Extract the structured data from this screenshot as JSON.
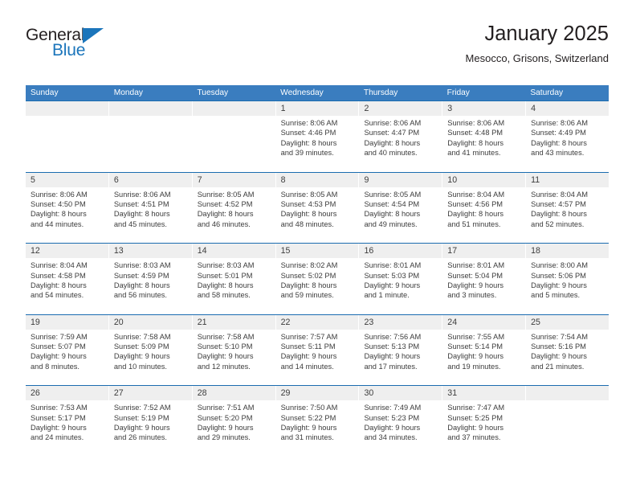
{
  "logo": {
    "line1": "General",
    "line2": "Blue",
    "triangle_color": "#1b75bb",
    "text_color": "#231f20"
  },
  "header": {
    "title": "January 2025",
    "subtitle": "Mesocco, Grisons, Switzerland"
  },
  "colors": {
    "weekday_header_bg": "#3a7dbf",
    "week_divider": "#1b6cb0",
    "day_band_bg": "#efefef",
    "text": "#3c3c3c"
  },
  "weekdays": [
    "Sunday",
    "Monday",
    "Tuesday",
    "Wednesday",
    "Thursday",
    "Friday",
    "Saturday"
  ],
  "weeks": [
    [
      {
        "day": "",
        "sunrise": "",
        "sunset": "",
        "daylight1": "",
        "daylight2": ""
      },
      {
        "day": "",
        "sunrise": "",
        "sunset": "",
        "daylight1": "",
        "daylight2": ""
      },
      {
        "day": "",
        "sunrise": "",
        "sunset": "",
        "daylight1": "",
        "daylight2": ""
      },
      {
        "day": "1",
        "sunrise": "Sunrise: 8:06 AM",
        "sunset": "Sunset: 4:46 PM",
        "daylight1": "Daylight: 8 hours",
        "daylight2": "and 39 minutes."
      },
      {
        "day": "2",
        "sunrise": "Sunrise: 8:06 AM",
        "sunset": "Sunset: 4:47 PM",
        "daylight1": "Daylight: 8 hours",
        "daylight2": "and 40 minutes."
      },
      {
        "day": "3",
        "sunrise": "Sunrise: 8:06 AM",
        "sunset": "Sunset: 4:48 PM",
        "daylight1": "Daylight: 8 hours",
        "daylight2": "and 41 minutes."
      },
      {
        "day": "4",
        "sunrise": "Sunrise: 8:06 AM",
        "sunset": "Sunset: 4:49 PM",
        "daylight1": "Daylight: 8 hours",
        "daylight2": "and 43 minutes."
      }
    ],
    [
      {
        "day": "5",
        "sunrise": "Sunrise: 8:06 AM",
        "sunset": "Sunset: 4:50 PM",
        "daylight1": "Daylight: 8 hours",
        "daylight2": "and 44 minutes."
      },
      {
        "day": "6",
        "sunrise": "Sunrise: 8:06 AM",
        "sunset": "Sunset: 4:51 PM",
        "daylight1": "Daylight: 8 hours",
        "daylight2": "and 45 minutes."
      },
      {
        "day": "7",
        "sunrise": "Sunrise: 8:05 AM",
        "sunset": "Sunset: 4:52 PM",
        "daylight1": "Daylight: 8 hours",
        "daylight2": "and 46 minutes."
      },
      {
        "day": "8",
        "sunrise": "Sunrise: 8:05 AM",
        "sunset": "Sunset: 4:53 PM",
        "daylight1": "Daylight: 8 hours",
        "daylight2": "and 48 minutes."
      },
      {
        "day": "9",
        "sunrise": "Sunrise: 8:05 AM",
        "sunset": "Sunset: 4:54 PM",
        "daylight1": "Daylight: 8 hours",
        "daylight2": "and 49 minutes."
      },
      {
        "day": "10",
        "sunrise": "Sunrise: 8:04 AM",
        "sunset": "Sunset: 4:56 PM",
        "daylight1": "Daylight: 8 hours",
        "daylight2": "and 51 minutes."
      },
      {
        "day": "11",
        "sunrise": "Sunrise: 8:04 AM",
        "sunset": "Sunset: 4:57 PM",
        "daylight1": "Daylight: 8 hours",
        "daylight2": "and 52 minutes."
      }
    ],
    [
      {
        "day": "12",
        "sunrise": "Sunrise: 8:04 AM",
        "sunset": "Sunset: 4:58 PM",
        "daylight1": "Daylight: 8 hours",
        "daylight2": "and 54 minutes."
      },
      {
        "day": "13",
        "sunrise": "Sunrise: 8:03 AM",
        "sunset": "Sunset: 4:59 PM",
        "daylight1": "Daylight: 8 hours",
        "daylight2": "and 56 minutes."
      },
      {
        "day": "14",
        "sunrise": "Sunrise: 8:03 AM",
        "sunset": "Sunset: 5:01 PM",
        "daylight1": "Daylight: 8 hours",
        "daylight2": "and 58 minutes."
      },
      {
        "day": "15",
        "sunrise": "Sunrise: 8:02 AM",
        "sunset": "Sunset: 5:02 PM",
        "daylight1": "Daylight: 8 hours",
        "daylight2": "and 59 minutes."
      },
      {
        "day": "16",
        "sunrise": "Sunrise: 8:01 AM",
        "sunset": "Sunset: 5:03 PM",
        "daylight1": "Daylight: 9 hours",
        "daylight2": "and 1 minute."
      },
      {
        "day": "17",
        "sunrise": "Sunrise: 8:01 AM",
        "sunset": "Sunset: 5:04 PM",
        "daylight1": "Daylight: 9 hours",
        "daylight2": "and 3 minutes."
      },
      {
        "day": "18",
        "sunrise": "Sunrise: 8:00 AM",
        "sunset": "Sunset: 5:06 PM",
        "daylight1": "Daylight: 9 hours",
        "daylight2": "and 5 minutes."
      }
    ],
    [
      {
        "day": "19",
        "sunrise": "Sunrise: 7:59 AM",
        "sunset": "Sunset: 5:07 PM",
        "daylight1": "Daylight: 9 hours",
        "daylight2": "and 8 minutes."
      },
      {
        "day": "20",
        "sunrise": "Sunrise: 7:58 AM",
        "sunset": "Sunset: 5:09 PM",
        "daylight1": "Daylight: 9 hours",
        "daylight2": "and 10 minutes."
      },
      {
        "day": "21",
        "sunrise": "Sunrise: 7:58 AM",
        "sunset": "Sunset: 5:10 PM",
        "daylight1": "Daylight: 9 hours",
        "daylight2": "and 12 minutes."
      },
      {
        "day": "22",
        "sunrise": "Sunrise: 7:57 AM",
        "sunset": "Sunset: 5:11 PM",
        "daylight1": "Daylight: 9 hours",
        "daylight2": "and 14 minutes."
      },
      {
        "day": "23",
        "sunrise": "Sunrise: 7:56 AM",
        "sunset": "Sunset: 5:13 PM",
        "daylight1": "Daylight: 9 hours",
        "daylight2": "and 17 minutes."
      },
      {
        "day": "24",
        "sunrise": "Sunrise: 7:55 AM",
        "sunset": "Sunset: 5:14 PM",
        "daylight1": "Daylight: 9 hours",
        "daylight2": "and 19 minutes."
      },
      {
        "day": "25",
        "sunrise": "Sunrise: 7:54 AM",
        "sunset": "Sunset: 5:16 PM",
        "daylight1": "Daylight: 9 hours",
        "daylight2": "and 21 minutes."
      }
    ],
    [
      {
        "day": "26",
        "sunrise": "Sunrise: 7:53 AM",
        "sunset": "Sunset: 5:17 PM",
        "daylight1": "Daylight: 9 hours",
        "daylight2": "and 24 minutes."
      },
      {
        "day": "27",
        "sunrise": "Sunrise: 7:52 AM",
        "sunset": "Sunset: 5:19 PM",
        "daylight1": "Daylight: 9 hours",
        "daylight2": "and 26 minutes."
      },
      {
        "day": "28",
        "sunrise": "Sunrise: 7:51 AM",
        "sunset": "Sunset: 5:20 PM",
        "daylight1": "Daylight: 9 hours",
        "daylight2": "and 29 minutes."
      },
      {
        "day": "29",
        "sunrise": "Sunrise: 7:50 AM",
        "sunset": "Sunset: 5:22 PM",
        "daylight1": "Daylight: 9 hours",
        "daylight2": "and 31 minutes."
      },
      {
        "day": "30",
        "sunrise": "Sunrise: 7:49 AM",
        "sunset": "Sunset: 5:23 PM",
        "daylight1": "Daylight: 9 hours",
        "daylight2": "and 34 minutes."
      },
      {
        "day": "31",
        "sunrise": "Sunrise: 7:47 AM",
        "sunset": "Sunset: 5:25 PM",
        "daylight1": "Daylight: 9 hours",
        "daylight2": "and 37 minutes."
      },
      {
        "day": "",
        "sunrise": "",
        "sunset": "",
        "daylight1": "",
        "daylight2": ""
      }
    ]
  ]
}
